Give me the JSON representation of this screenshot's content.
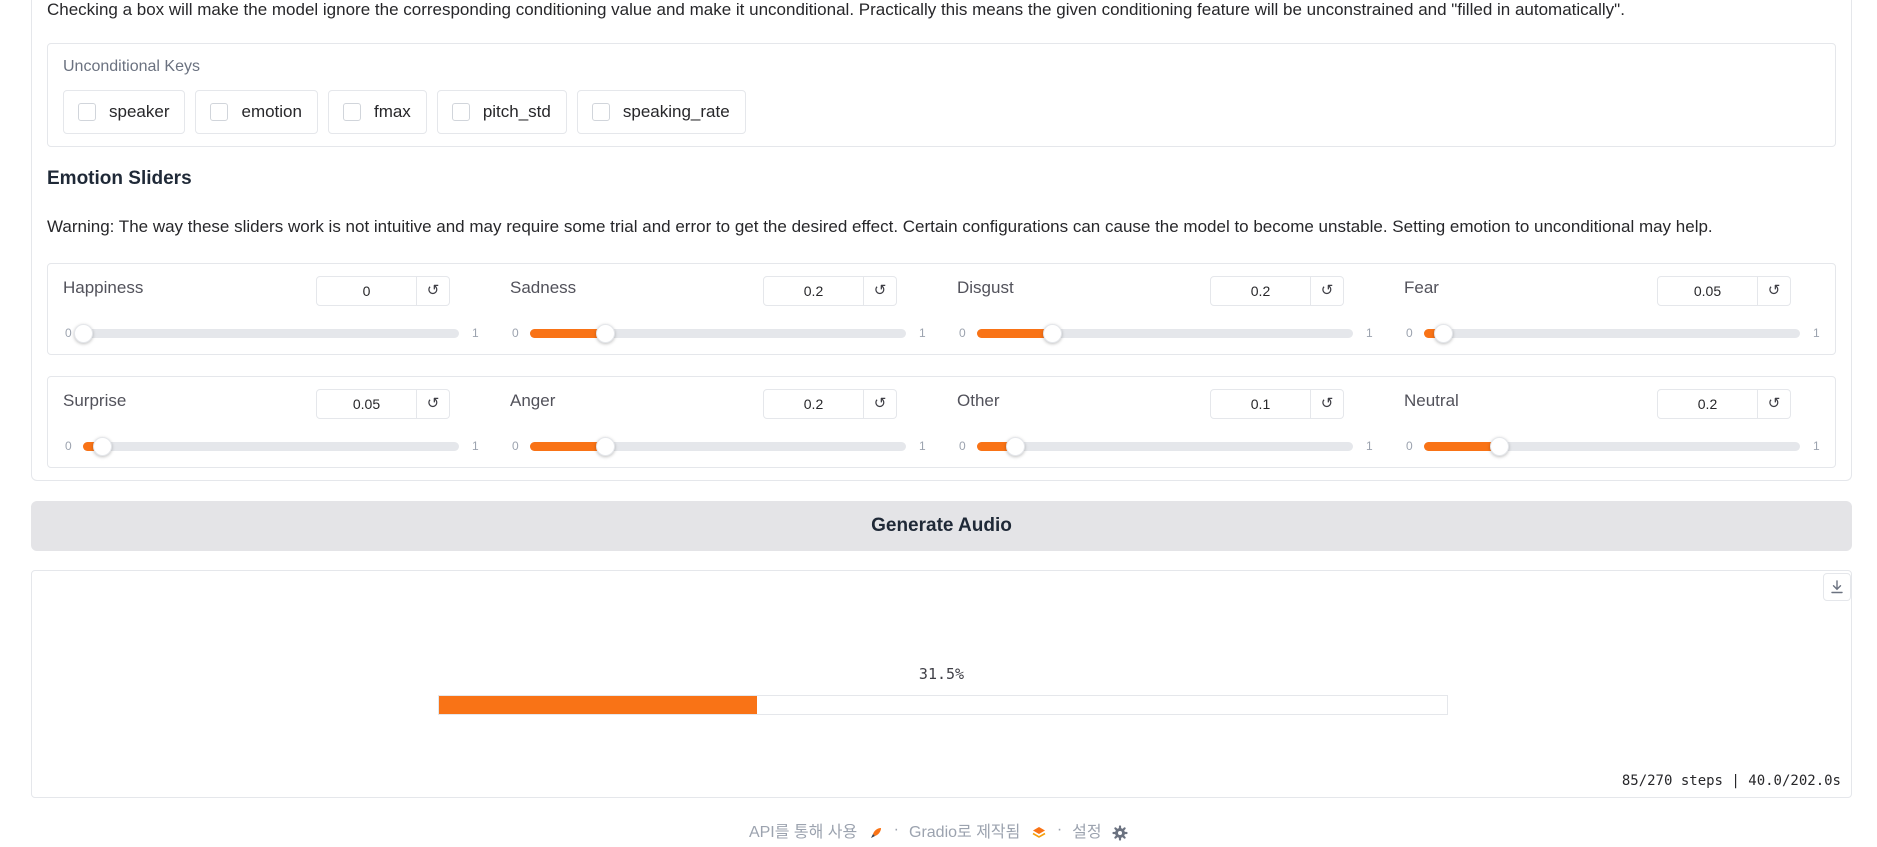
{
  "info_text": "Checking a box will make the model ignore the corresponding conditioning value and make it unconditional. Practically this means the given conditioning feature will be unconstrained and \"filled in automatically\".",
  "unconditional": {
    "label": "Unconditional Keys",
    "options": [
      {
        "label": "speaker",
        "checked": false
      },
      {
        "label": "emotion",
        "checked": false
      },
      {
        "label": "fmax",
        "checked": false
      },
      {
        "label": "pitch_std",
        "checked": false
      },
      {
        "label": "speaking_rate",
        "checked": false
      }
    ]
  },
  "emotion": {
    "title": "Emotion Sliders",
    "warning": "Warning: The way these sliders work is not intuitive and may require some trial and error to get the desired effect. Certain configurations can cause the model to become unstable. Setting emotion to unconditional may help.",
    "min_label": "0",
    "max_label": "1",
    "reset_glyph": "↺",
    "sliders": [
      {
        "label": "Happiness",
        "value": "0",
        "fraction": 0.0
      },
      {
        "label": "Sadness",
        "value": "0.2",
        "fraction": 0.2
      },
      {
        "label": "Disgust",
        "value": "0.2",
        "fraction": 0.2
      },
      {
        "label": "Fear",
        "value": "0.05",
        "fraction": 0.05
      },
      {
        "label": "Surprise",
        "value": "0.05",
        "fraction": 0.05
      },
      {
        "label": "Anger",
        "value": "0.2",
        "fraction": 0.2
      },
      {
        "label": "Other",
        "value": "0.1",
        "fraction": 0.1
      },
      {
        "label": "Neutral",
        "value": "0.2",
        "fraction": 0.2
      }
    ]
  },
  "generate_button": "Generate Audio",
  "progress": {
    "percent_text": "31.5%",
    "fraction": 0.315,
    "steps_text": "85/270 steps | 40.0/202.0s"
  },
  "footer": {
    "api": "API를 통해 사용",
    "built": "Gradio로 제작됨",
    "settings": "설정",
    "separator": "·"
  },
  "colors": {
    "accent": "#f97316",
    "border": "#e5e7eb",
    "button_bg": "#e4e4e7"
  }
}
